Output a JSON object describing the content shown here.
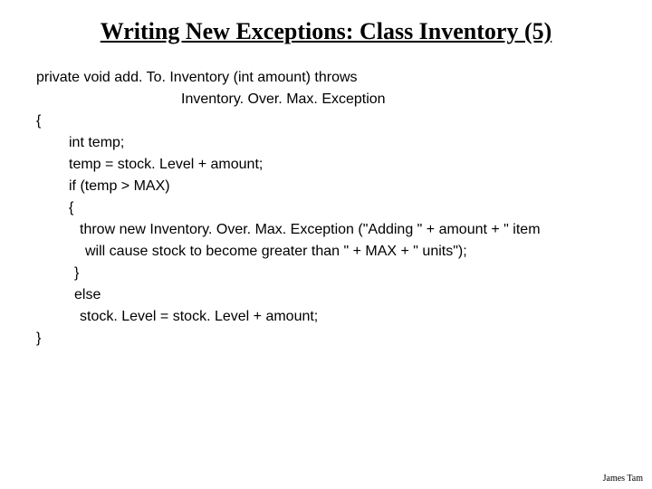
{
  "title": "Writing New Exceptions: Class Inventory (5)",
  "code": {
    "sig1": "private void add. To. Inventory (int amount) throws",
    "sig2": "Inventory. Over. Max. Exception",
    "open": "{",
    "line1": "int temp;",
    "line2": "temp = stock. Level + amount;",
    "line3": "if (temp > MAX)",
    "open2": "{",
    "line4": "throw new Inventory. Over. Max. Exception (\"Adding \" + amount + \" item",
    "line5": "will cause stock to become greater than \" + MAX + \" units\");",
    "close2": "}",
    "line6": "else",
    "line7": "stock. Level = stock. Level + amount;",
    "close": "}"
  },
  "footer": "James Tam"
}
